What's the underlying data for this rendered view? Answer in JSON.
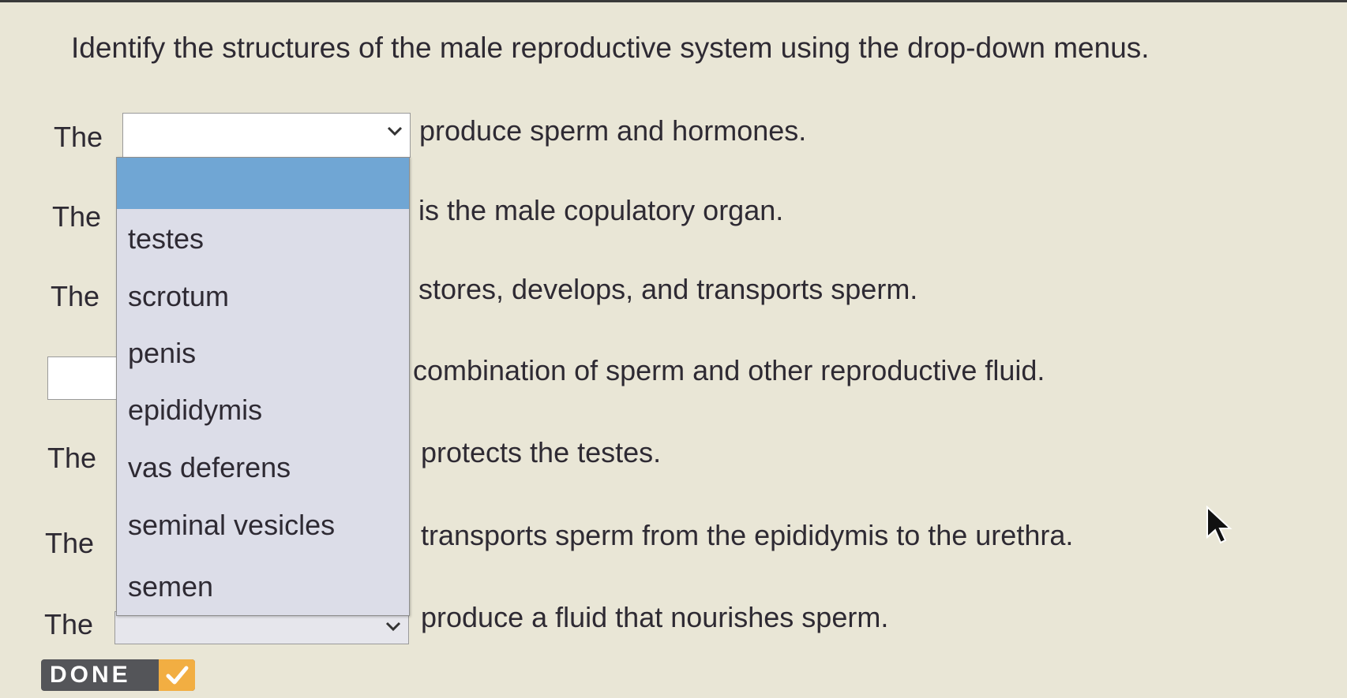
{
  "instruction": "Identify the structures of the male reproductive system using the drop-down menus.",
  "rows": [
    {
      "prefix": "The",
      "suffix": "produce sperm and hormones."
    },
    {
      "prefix": "The",
      "suffix": "is the male copulatory organ."
    },
    {
      "prefix": "The",
      "suffix": "stores, develops, and transports sperm."
    },
    {
      "prefix": "",
      "suffix": "combination of sperm and other reproductive fluid."
    },
    {
      "prefix": "The",
      "suffix": "protects the testes."
    },
    {
      "prefix": "The",
      "suffix": "transports sperm from the epididymis to the urethra."
    },
    {
      "prefix": "The",
      "suffix": "produce a fluid that nourishes sperm."
    }
  ],
  "dropdown": {
    "selected": "",
    "options": [
      "testes",
      "scrotum",
      "penis",
      "epididymis",
      "vas deferens",
      "seminal vesicles",
      "semen"
    ]
  },
  "done_button": {
    "label": "DONE"
  },
  "colors": {
    "highlight": "#70a6d4",
    "menu_bg": "#dcdde8",
    "done_bg": "#545559",
    "done_check": "#f2ae42"
  }
}
